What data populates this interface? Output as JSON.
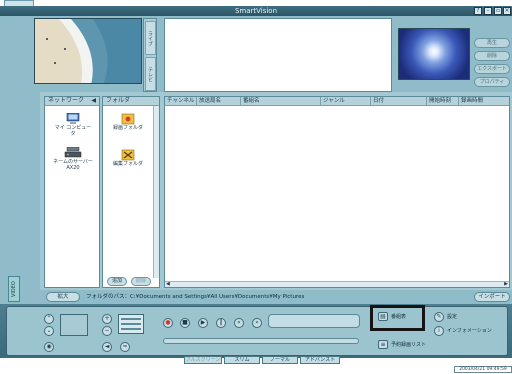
{
  "window": {
    "title": "SmartVision"
  },
  "side_tabs": [
    "ライブ",
    "テレビ"
  ],
  "side_buttons": [
    "再生",
    "削除",
    "エクスポート",
    "プロパティ"
  ],
  "network_pane": {
    "title": "ネットワーク",
    "items": [
      {
        "label": "マイ コンピュータ",
        "icon": "computer-icon"
      },
      {
        "label": "ネームのサーバー AX20",
        "icon": "server-icon"
      }
    ]
  },
  "folder_pane": {
    "title": "フォルダ",
    "items": [
      {
        "label": "録画フォルダ",
        "icon": "record-folder-icon"
      },
      {
        "label": "編集フォルダ",
        "icon": "edit-folder-icon"
      }
    ],
    "buttons": [
      "追加",
      "削除"
    ]
  },
  "list": {
    "columns": [
      "チャンネル",
      "放送局名",
      "番組名",
      "ジャンル",
      "日付",
      "開始時刻",
      "録画時間"
    ]
  },
  "path_bar": {
    "expand": "拡大",
    "label": "フォルダのパス：",
    "path": "C:¥Documents and Settings¥All Users¥Documents¥My Pictures",
    "import": "インポート"
  },
  "controls": {
    "schedule_label": "番組表",
    "reservation_label": "予約録画リスト",
    "settings_label": "設定",
    "info_label": "インフォメーション"
  },
  "video_tab": "VIDEO",
  "mode_tabs": [
    "フルスクリーン",
    "スリム",
    "ノーマル",
    "アドバンスト"
  ],
  "status": {
    "datetime": "2003/04/21 09:49:59"
  }
}
